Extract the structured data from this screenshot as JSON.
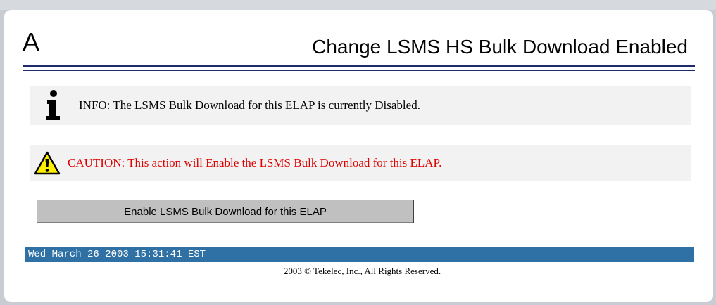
{
  "header": {
    "letter": "A",
    "title": "Change LSMS HS Bulk Download Enabled"
  },
  "info": {
    "icon": "info-icon",
    "text": "INFO: The LSMS Bulk Download for this ELAP is currently Disabled."
  },
  "caution": {
    "icon": "warning-icon",
    "text": "CAUTION: This action will Enable the LSMS Bulk Download for this ELAP.",
    "color": "#e00000"
  },
  "action": {
    "button_label": "Enable LSMS Bulk Download for this ELAP"
  },
  "status": {
    "timestamp": "Wed March 26 2003 15:31:41 EST",
    "bar_color": "#2f71a5"
  },
  "footer": {
    "copyright": "2003 © Tekelec, Inc., All Rights Reserved."
  }
}
